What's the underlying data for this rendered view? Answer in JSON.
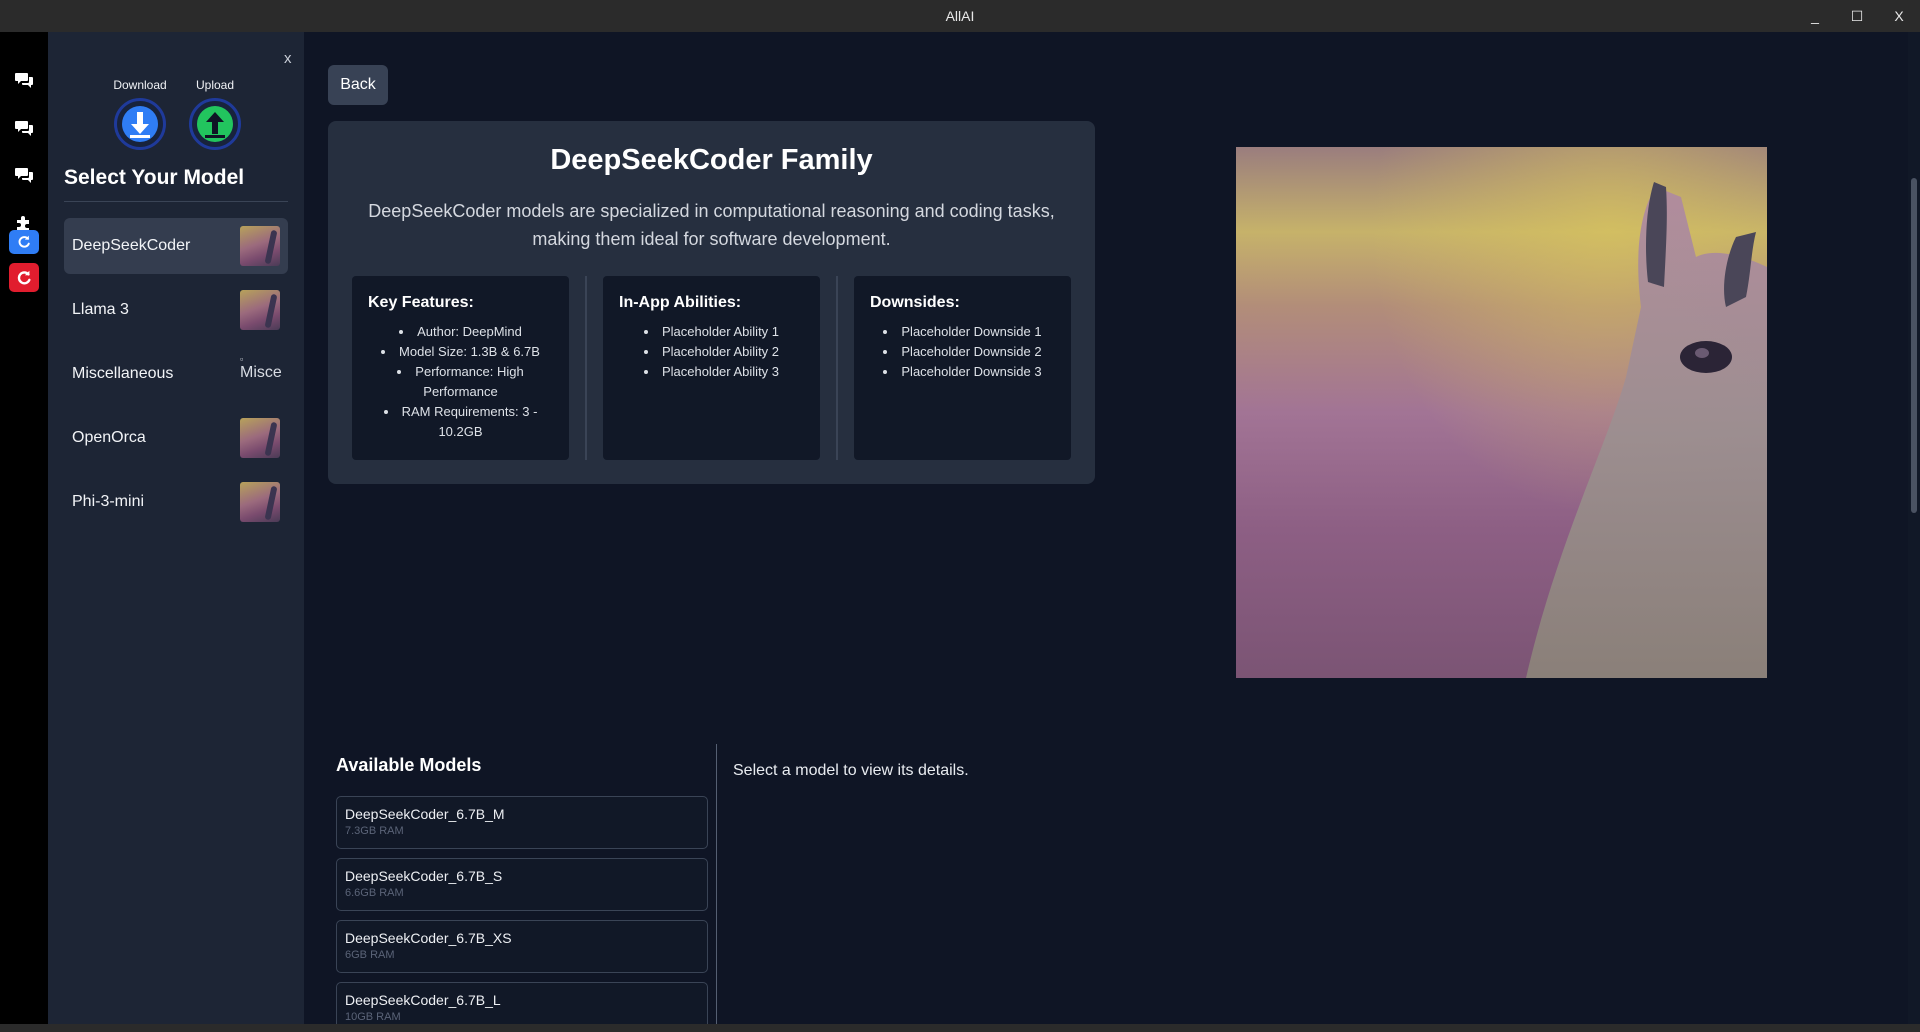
{
  "window": {
    "title": "AllAI",
    "controls": [
      "_",
      "☐",
      "X"
    ]
  },
  "sidebar": {
    "close_label": "x",
    "download_label": "Download",
    "upload_label": "Upload",
    "heading": "Select Your Model",
    "models": [
      {
        "name": "DeepSeekCoder",
        "active": true
      },
      {
        "name": "Llama 3",
        "active": false
      },
      {
        "name": "Miscellaneous",
        "active": false,
        "image_alt": "Misce"
      },
      {
        "name": "OpenOrca",
        "active": false
      },
      {
        "name": "Phi-3-mini",
        "active": false
      }
    ]
  },
  "main": {
    "back_label": "Back",
    "family": {
      "title": "DeepSeekCoder Family",
      "description": "DeepSeekCoder models are specialized in computational reasoning and coding tasks, making them ideal for software development.",
      "key_features": {
        "title": "Key Features:",
        "items": [
          "Author: DeepMind",
          "Model Size: 1.3B & 6.7B",
          "Performance: High Performance",
          "RAM Requirements: 3 - 10.2GB"
        ]
      },
      "abilities": {
        "title": "In-App Abilities:",
        "items": [
          "Placeholder Ability 1",
          "Placeholder Ability 2",
          "Placeholder Ability 3"
        ]
      },
      "downsides": {
        "title": "Downsides:",
        "items": [
          "Placeholder Downside 1",
          "Placeholder Downside 2",
          "Placeholder Downside 3"
        ]
      }
    },
    "available": {
      "title": "Available Models",
      "models": [
        {
          "name": "DeepSeekCoder_6.7B_M",
          "ram": "7.3GB RAM"
        },
        {
          "name": "DeepSeekCoder_6.7B_S",
          "ram": "6.6GB RAM"
        },
        {
          "name": "DeepSeekCoder_6.7B_XS",
          "ram": "6GB RAM"
        },
        {
          "name": "DeepSeekCoder_6.7B_L",
          "ram": "10GB RAM"
        }
      ]
    },
    "details_placeholder": "Select a model to view its details."
  },
  "icons": {
    "rail": [
      "chat-icon",
      "chat-icon",
      "chat-icon",
      "puzzle-icon",
      "refresh-icon",
      "refresh-icon"
    ],
    "download": "download-icon",
    "upload": "upload-icon"
  },
  "colors": {
    "download_accent": "#2f7df5",
    "upload_accent": "#22c55e",
    "refresh_blue": "#2f7df5",
    "refresh_red": "#e11d2e"
  }
}
